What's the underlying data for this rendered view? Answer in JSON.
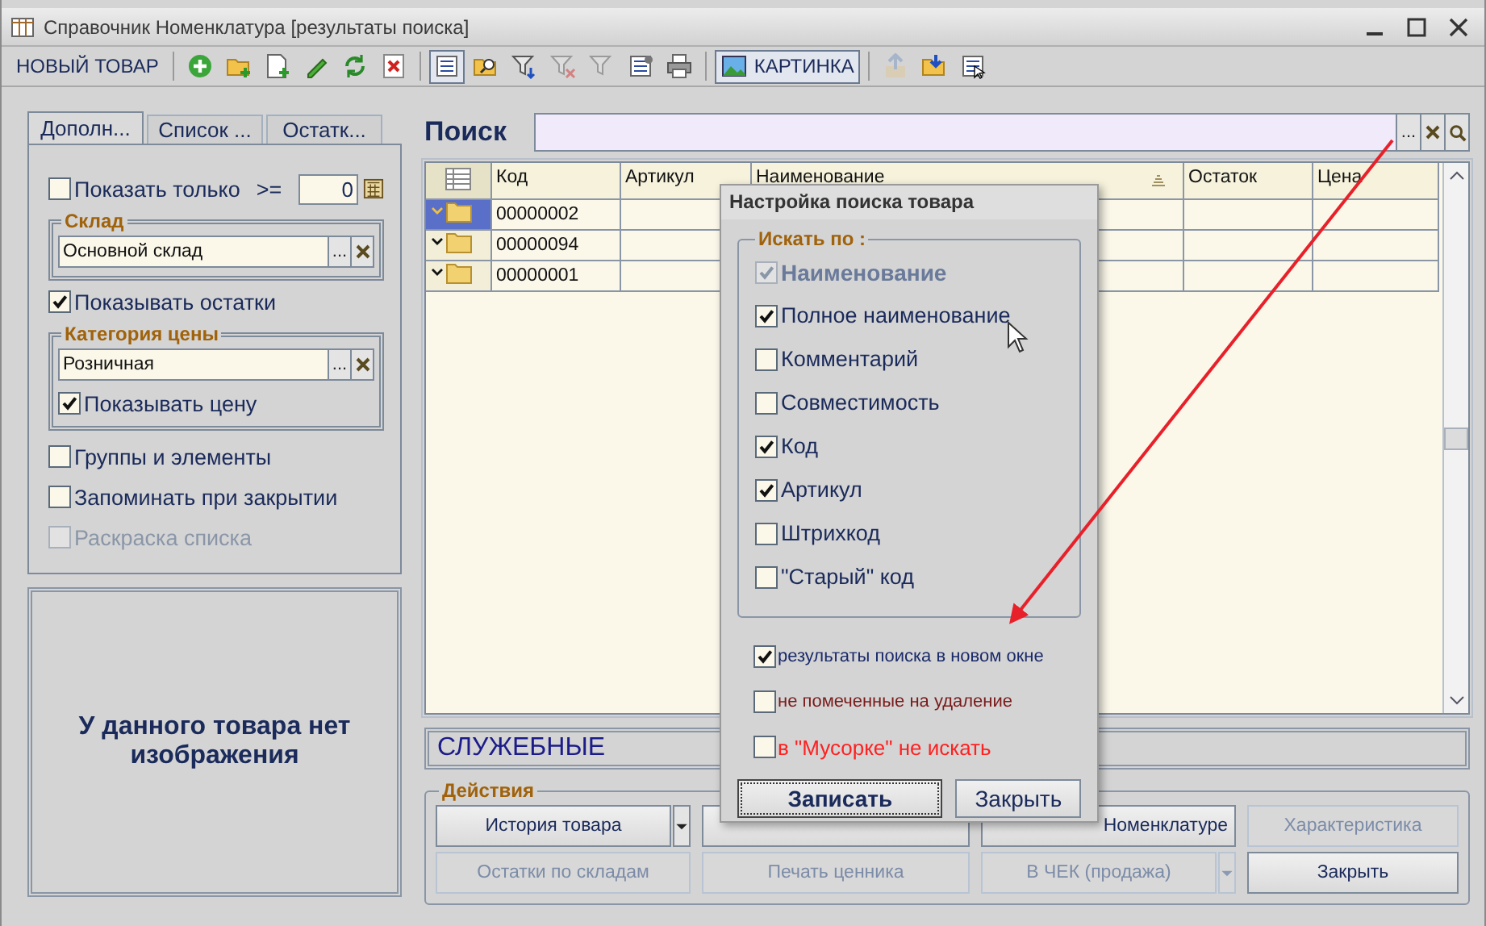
{
  "window": {
    "title": "Справочник Номенклатура [результаты поиска]"
  },
  "toolbar": [
    {
      "kind": "text",
      "label": "НОВЫЙ ТОВАР",
      "pressed": false,
      "disabled": false
    },
    {
      "kind": "separator"
    },
    {
      "kind": "icon",
      "pressed": false,
      "disabled": false
    },
    {
      "kind": "icon",
      "pressed": false,
      "disabled": false
    },
    {
      "kind": "icon",
      "pressed": false,
      "disabled": false
    },
    {
      "kind": "icon",
      "pressed": false,
      "disabled": false
    },
    {
      "kind": "icon",
      "pressed": false,
      "disabled": false
    },
    {
      "kind": "icon",
      "pressed": false,
      "disabled": false
    },
    {
      "kind": "separator"
    },
    {
      "kind": "icon",
      "pressed": true,
      "disabled": false
    },
    {
      "kind": "icon",
      "pressed": false,
      "disabled": false
    },
    {
      "kind": "icon",
      "pressed": false,
      "disabled": false
    },
    {
      "kind": "icon",
      "pressed": false,
      "disabled": true
    },
    {
      "kind": "icon",
      "pressed": false,
      "disabled": true
    },
    {
      "kind": "icon",
      "pressed": false,
      "disabled": false
    },
    {
      "kind": "icon",
      "pressed": false,
      "disabled": false
    },
    {
      "kind": "separator"
    },
    {
      "kind": "icon_text",
      "label": "КАРТИНКА",
      "pressed": true,
      "disabled": false
    },
    {
      "kind": "separator"
    },
    {
      "kind": "icon",
      "pressed": false,
      "disabled": true
    },
    {
      "kind": "icon",
      "pressed": false,
      "disabled": false
    },
    {
      "kind": "icon",
      "pressed": false,
      "disabled": false
    }
  ],
  "side_tabs": [
    {
      "label": "Дополн...",
      "selected": true
    },
    {
      "label": "Список ...",
      "selected": false
    },
    {
      "label": "Остатк...",
      "selected": false
    }
  ],
  "options": {
    "show_only": {
      "label": "Показать только",
      "operator": ">=",
      "checked": false,
      "value": "0"
    },
    "warehouse": {
      "legend": "Склад",
      "value": "Основной склад",
      "choose": "..."
    },
    "show_stock": {
      "label": "Показывать остатки",
      "checked": true
    },
    "price_category": {
      "legend": "Категория цены",
      "value": "Розничная",
      "choose": "...",
      "show_price": {
        "label": "Показывать цену",
        "checked": true
      }
    },
    "checks": [
      {
        "label": "Группы и элементы",
        "checked": false,
        "disabled": false
      },
      {
        "label": "Запоминать при закрытии",
        "checked": false,
        "disabled": false
      },
      {
        "label": "Раскраска списка",
        "checked": false,
        "disabled": true
      }
    ]
  },
  "image_panel": {
    "message": "У данного товара нет изображения"
  },
  "search": {
    "label": "Поиск",
    "choose": "..."
  },
  "table": {
    "columns": [
      "Код",
      "Артикул",
      "Наименование",
      "Остаток",
      "Цена"
    ],
    "rows": [
      {
        "code": "00000002",
        "selected": true
      },
      {
        "code": "00000094",
        "selected": false
      },
      {
        "code": "00000001",
        "selected": false
      }
    ]
  },
  "category_bar": {
    "text": "СЛУЖЕБНЫЕ"
  },
  "actions": {
    "legend": "Действия",
    "buttons": [
      {
        "label": "История товара",
        "disabled": false,
        "dropdown": true
      },
      {
        "disabled": false,
        "dropdown": false
      },
      {
        "label": "Номенклатуре",
        "disabled": false,
        "dropdown": false
      },
      {
        "label": "Характеристика",
        "disabled": true,
        "dropdown": false
      },
      {
        "label": "Остатки по складам",
        "disabled": true,
        "dropdown": false
      },
      {
        "label": "Печать ценника",
        "disabled": true,
        "dropdown": false
      },
      {
        "label": "В ЧЕК (продажа)",
        "disabled": true,
        "dropdown": true
      },
      {
        "label": "Закрыть",
        "disabled": false,
        "dropdown": false
      }
    ]
  },
  "search_dialog": {
    "title": "Настройка поиска товара",
    "legend": "Искать по :",
    "fields": [
      {
        "label": "Наименование",
        "checked": true,
        "disabled": true
      },
      {
        "label": "Полное наименование",
        "checked": true,
        "disabled": false
      },
      {
        "label": "Комментарий",
        "checked": false,
        "disabled": false
      },
      {
        "label": "Совместимость",
        "checked": false,
        "disabled": false
      },
      {
        "label": "Код",
        "checked": true,
        "disabled": false
      },
      {
        "label": "Артикул",
        "checked": true,
        "disabled": false
      },
      {
        "label": "Штрихкод",
        "checked": false,
        "disabled": false
      },
      {
        "label": "\"Старый\" код",
        "checked": false,
        "disabled": false
      }
    ],
    "options": [
      {
        "label": "результаты поиска в новом окне",
        "checked": true,
        "color": "#1a2a6a"
      },
      {
        "label": "не помеченные на удаление",
        "checked": false,
        "color": "#7a1a1a"
      },
      {
        "label": "в \"Мусорке\" не искать",
        "checked": false,
        "color": "#ff2020"
      }
    ],
    "buttons": [
      {
        "label": "Записать",
        "default": true
      },
      {
        "label": "Закрыть",
        "default": false
      }
    ]
  }
}
